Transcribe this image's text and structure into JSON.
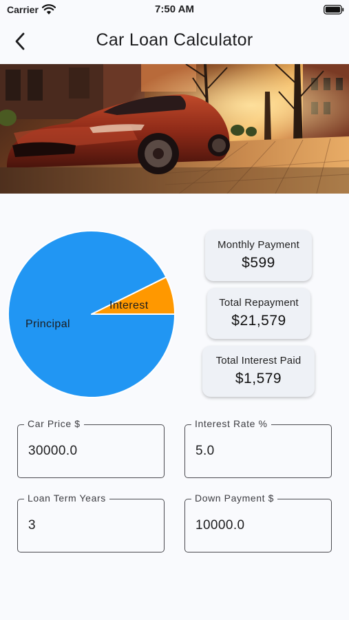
{
  "status_bar": {
    "carrier": "Carrier",
    "time": "7:50 AM"
  },
  "nav": {
    "title": "Car Loan Calculator",
    "back_icon": "chevron-left-icon"
  },
  "hero": {
    "image": "red sports car parked on a sunlit street"
  },
  "chart_data": {
    "type": "pie",
    "labels": [
      "Principal",
      "Interest"
    ],
    "values": [
      20000,
      1579
    ],
    "colors": [
      "#2196f3",
      "#ff9800"
    ]
  },
  "summary": {
    "monthly_payment": {
      "label": "Monthly Payment",
      "value": "$599"
    },
    "total_repayment": {
      "label": "Total Repayment",
      "value": "$21,579"
    },
    "total_interest": {
      "label": "Total Interest Paid",
      "value": "$1,579"
    }
  },
  "form": {
    "car_price": {
      "label": "Car Price $",
      "value": "30000.0"
    },
    "interest_rate": {
      "label": "Interest Rate %",
      "value": "5.0"
    },
    "loan_term": {
      "label": "Loan Term Years",
      "value": "3"
    },
    "down_payment": {
      "label": "Down Payment $",
      "value": "10000.0"
    }
  }
}
